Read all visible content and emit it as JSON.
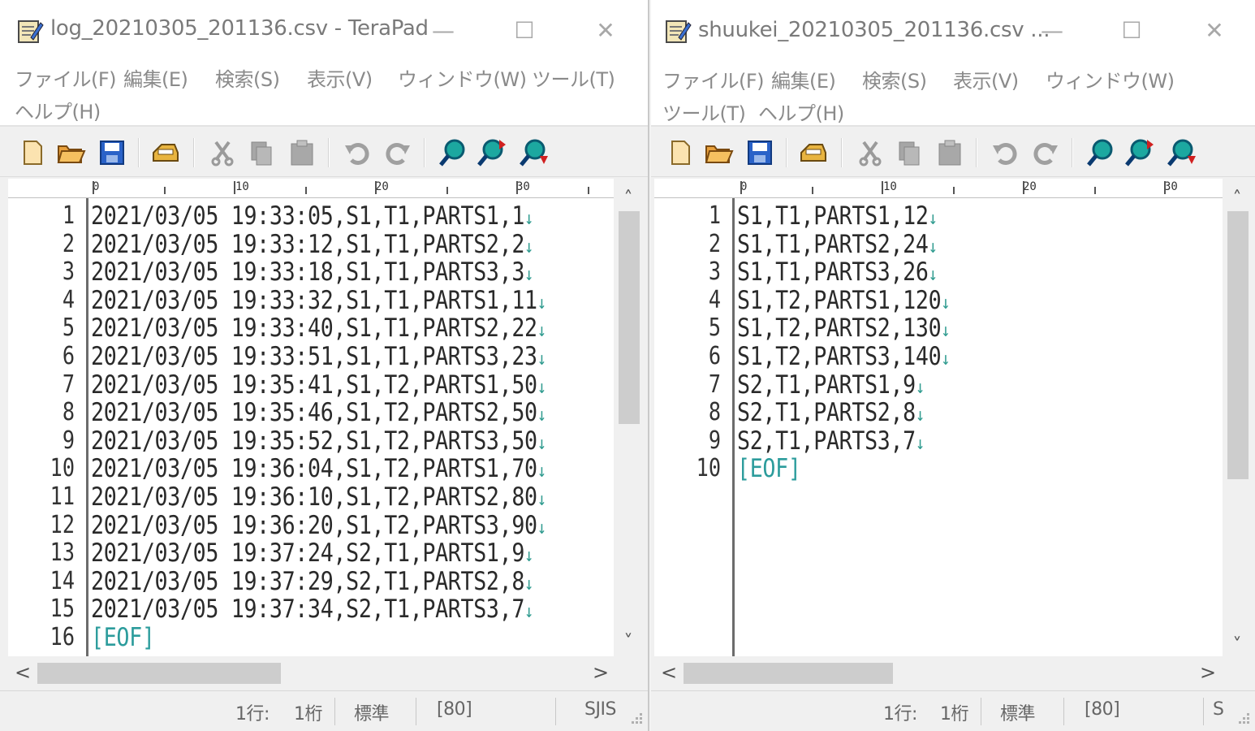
{
  "left": {
    "title": "log_20210305_201136.csv - TeraPad",
    "menu": [
      "ファイル(F)",
      "編集(E)",
      "検索(S)",
      "表示(V)",
      "ウィンドウ(W)",
      "ツール(T)",
      "ヘルプ(H)"
    ],
    "ruler": [
      "0",
      "10",
      "20",
      "30"
    ],
    "lines": [
      {
        "num": "1",
        "text": "2021/03/05 19:33:05,S1,T1,PARTS1,1",
        "nl": "↓"
      },
      {
        "num": "2",
        "text": "2021/03/05 19:33:12,S1,T1,PARTS2,2",
        "nl": "↓"
      },
      {
        "num": "3",
        "text": "2021/03/05 19:33:18,S1,T1,PARTS3,3",
        "nl": "↓"
      },
      {
        "num": "4",
        "text": "2021/03/05 19:33:32,S1,T1,PARTS1,11",
        "nl": "↓"
      },
      {
        "num": "5",
        "text": "2021/03/05 19:33:40,S1,T1,PARTS2,22",
        "nl": "↓"
      },
      {
        "num": "6",
        "text": "2021/03/05 19:33:51,S1,T1,PARTS3,23",
        "nl": "↓"
      },
      {
        "num": "7",
        "text": "2021/03/05 19:35:41,S1,T2,PARTS1,50",
        "nl": "↓"
      },
      {
        "num": "8",
        "text": "2021/03/05 19:35:46,S1,T2,PARTS2,50",
        "nl": "↓"
      },
      {
        "num": "9",
        "text": "2021/03/05 19:35:52,S1,T2,PARTS3,50",
        "nl": "↓"
      },
      {
        "num": "10",
        "text": "2021/03/05 19:36:04,S1,T2,PARTS1,70",
        "nl": "↓"
      },
      {
        "num": "11",
        "text": "2021/03/05 19:36:10,S1,T2,PARTS2,80",
        "nl": "↓"
      },
      {
        "num": "12",
        "text": "2021/03/05 19:36:20,S1,T2,PARTS3,90",
        "nl": "↓"
      },
      {
        "num": "13",
        "text": "2021/03/05 19:37:24,S2,T1,PARTS1,9",
        "nl": "↓"
      },
      {
        "num": "14",
        "text": "2021/03/05 19:37:29,S2,T1,PARTS2,8",
        "nl": "↓"
      },
      {
        "num": "15",
        "text": "2021/03/05 19:37:34,S2,T1,PARTS3,7",
        "nl": "↓"
      },
      {
        "num": "16",
        "text": "[EOF]",
        "nl": ""
      }
    ],
    "status": {
      "row": "1行:",
      "col": "1桁",
      "mode": "標準",
      "ins": "[80]",
      "enc": "SJIS"
    }
  },
  "right": {
    "title": "shuukei_20210305_201136.csv ...",
    "menu": [
      "ファイル(F)",
      "編集(E)",
      "検索(S)",
      "表示(V)",
      "ウィンドウ(W)",
      "ツール(T)",
      "ヘルプ(H)"
    ],
    "ruler": [
      "0",
      "10",
      "20",
      "30"
    ],
    "lines": [
      {
        "num": "1",
        "text": "S1,T1,PARTS1,12",
        "nl": "↓"
      },
      {
        "num": "2",
        "text": "S1,T1,PARTS2,24",
        "nl": "↓"
      },
      {
        "num": "3",
        "text": "S1,T1,PARTS3,26",
        "nl": "↓"
      },
      {
        "num": "4",
        "text": "S1,T2,PARTS1,120",
        "nl": "↓"
      },
      {
        "num": "5",
        "text": "S1,T2,PARTS2,130",
        "nl": "↓"
      },
      {
        "num": "6",
        "text": "S1,T2,PARTS3,140",
        "nl": "↓"
      },
      {
        "num": "7",
        "text": "S2,T1,PARTS1,9",
        "nl": "↓"
      },
      {
        "num": "8",
        "text": "S2,T1,PARTS2,8",
        "nl": "↓"
      },
      {
        "num": "9",
        "text": "S2,T1,PARTS3,7",
        "nl": "↓"
      },
      {
        "num": "10",
        "text": "[EOF]",
        "nl": ""
      }
    ],
    "status": {
      "row": "1行:",
      "col": "1桁",
      "mode": "標準",
      "ins": "[80]",
      "enc": "S"
    }
  },
  "window_controls": {
    "minimize": "—",
    "maximize": "☐",
    "close": "✕"
  },
  "scroll": {
    "up": "˄",
    "down": "˅",
    "left": "<",
    "right": ">"
  }
}
